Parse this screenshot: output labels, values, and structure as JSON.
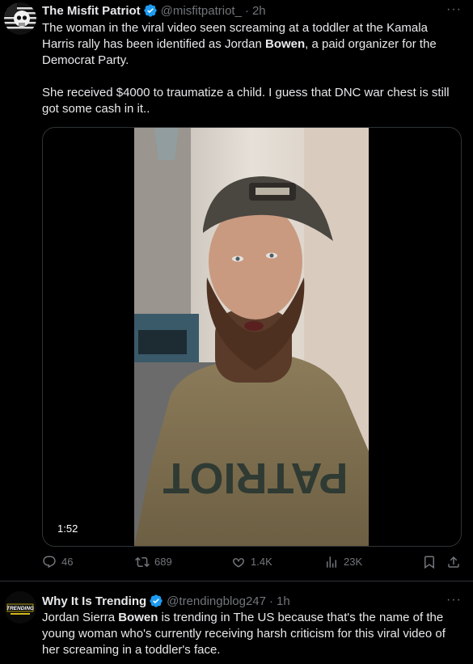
{
  "tweet1": {
    "display_name": "The Misfit Patriot",
    "handle": "@misfitpatriot_",
    "separator": "·",
    "time": "2h",
    "more": "···",
    "text_line1_prefix": "The woman in the viral video seen screaming at a toddler at the Kamala Harris rally has been identified as Jordan ",
    "text_line1_bold": "Bowen",
    "text_line1_suffix": ", a paid organizer for the Democrat Party.",
    "text_paragraph2": "She received $4000 to traumatize a child. I guess that DNC war chest is still got some cash in it..",
    "video_duration": "1:52",
    "shirt_text": "PATRIOT",
    "cap_text": "",
    "actions": {
      "replies": "46",
      "reposts": "689",
      "likes": "1.4K",
      "views": "23K"
    }
  },
  "tweet2": {
    "display_name": "Why It Is Trending",
    "handle": "@trendingblog247",
    "separator": "·",
    "time": "1h",
    "more": "···",
    "avatar_text": "TRENDING",
    "text_prefix": "Jordan Sierra ",
    "text_bold": "Bowen",
    "text_suffix": " is trending in The US because that's the name of the young woman who's currently receiving harsh criticism for this viral video of her screaming in a toddler's face."
  },
  "colors": {
    "background": "#000000",
    "text": "#e7e9ea",
    "secondary": "#71767b",
    "verified": "#1d9bf0",
    "divider": "#2f3336"
  },
  "icons": [
    "reply-icon",
    "repost-icon",
    "like-icon",
    "views-icon",
    "bookmark-icon",
    "share-icon",
    "verified-badge-icon"
  ]
}
